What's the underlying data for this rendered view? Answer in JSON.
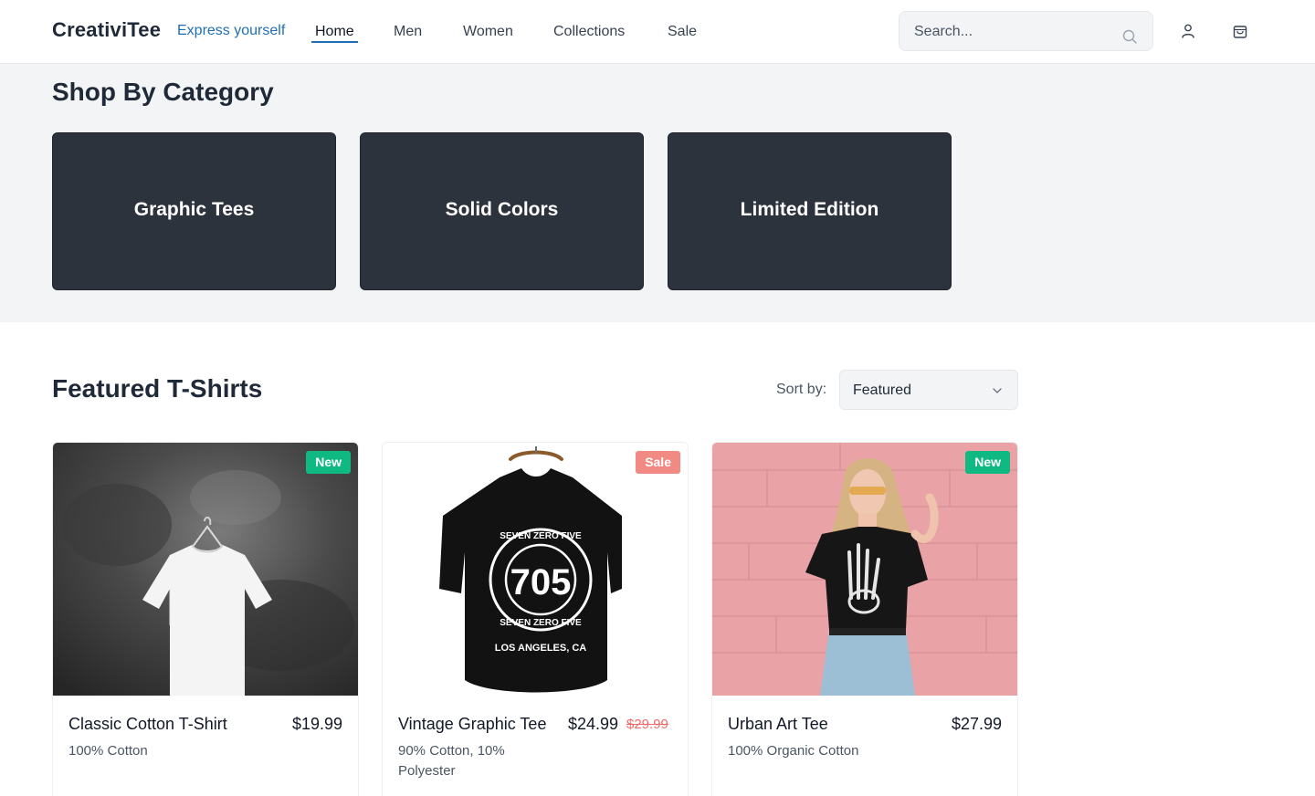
{
  "header": {
    "logo": "CreativiTee",
    "tagline": "Express yourself",
    "nav": [
      "Home",
      "Men",
      "Women",
      "Collections",
      "Sale"
    ],
    "active_nav": "Home",
    "search_placeholder": "Search..."
  },
  "categories": {
    "title": "Shop By Category",
    "items": [
      "Graphic Tees",
      "Solid Colors",
      "Limited Edition"
    ]
  },
  "featured": {
    "title": "Featured T-Shirts",
    "sort_label": "Sort by:",
    "sort_value": "Featured",
    "products": [
      {
        "name": "Classic Cotton T-Shirt",
        "price": "$19.99",
        "old_price": "",
        "desc": "100% Cotton",
        "badge": "New"
      },
      {
        "name": "Vintage Graphic Tee",
        "price": "$24.99",
        "old_price": "$29.99",
        "desc": "90% Cotton, 10% Polyester",
        "badge": "Sale"
      },
      {
        "name": "Urban Art Tee",
        "price": "$27.99",
        "old_price": "",
        "desc": "100% Organic Cotton",
        "badge": "New"
      }
    ],
    "shirt_print": {
      "ring_top": "SEVEN ZERO FIVE",
      "number": "705",
      "ring_bottom": "SEVEN ZERO FIVE",
      "city": "LOS ANGELES, CA"
    }
  },
  "colors": {
    "accent": "#1f6fb6",
    "card_dark": "#2d333c",
    "badge_new": "#10b981",
    "badge_sale": "#f08a83"
  }
}
